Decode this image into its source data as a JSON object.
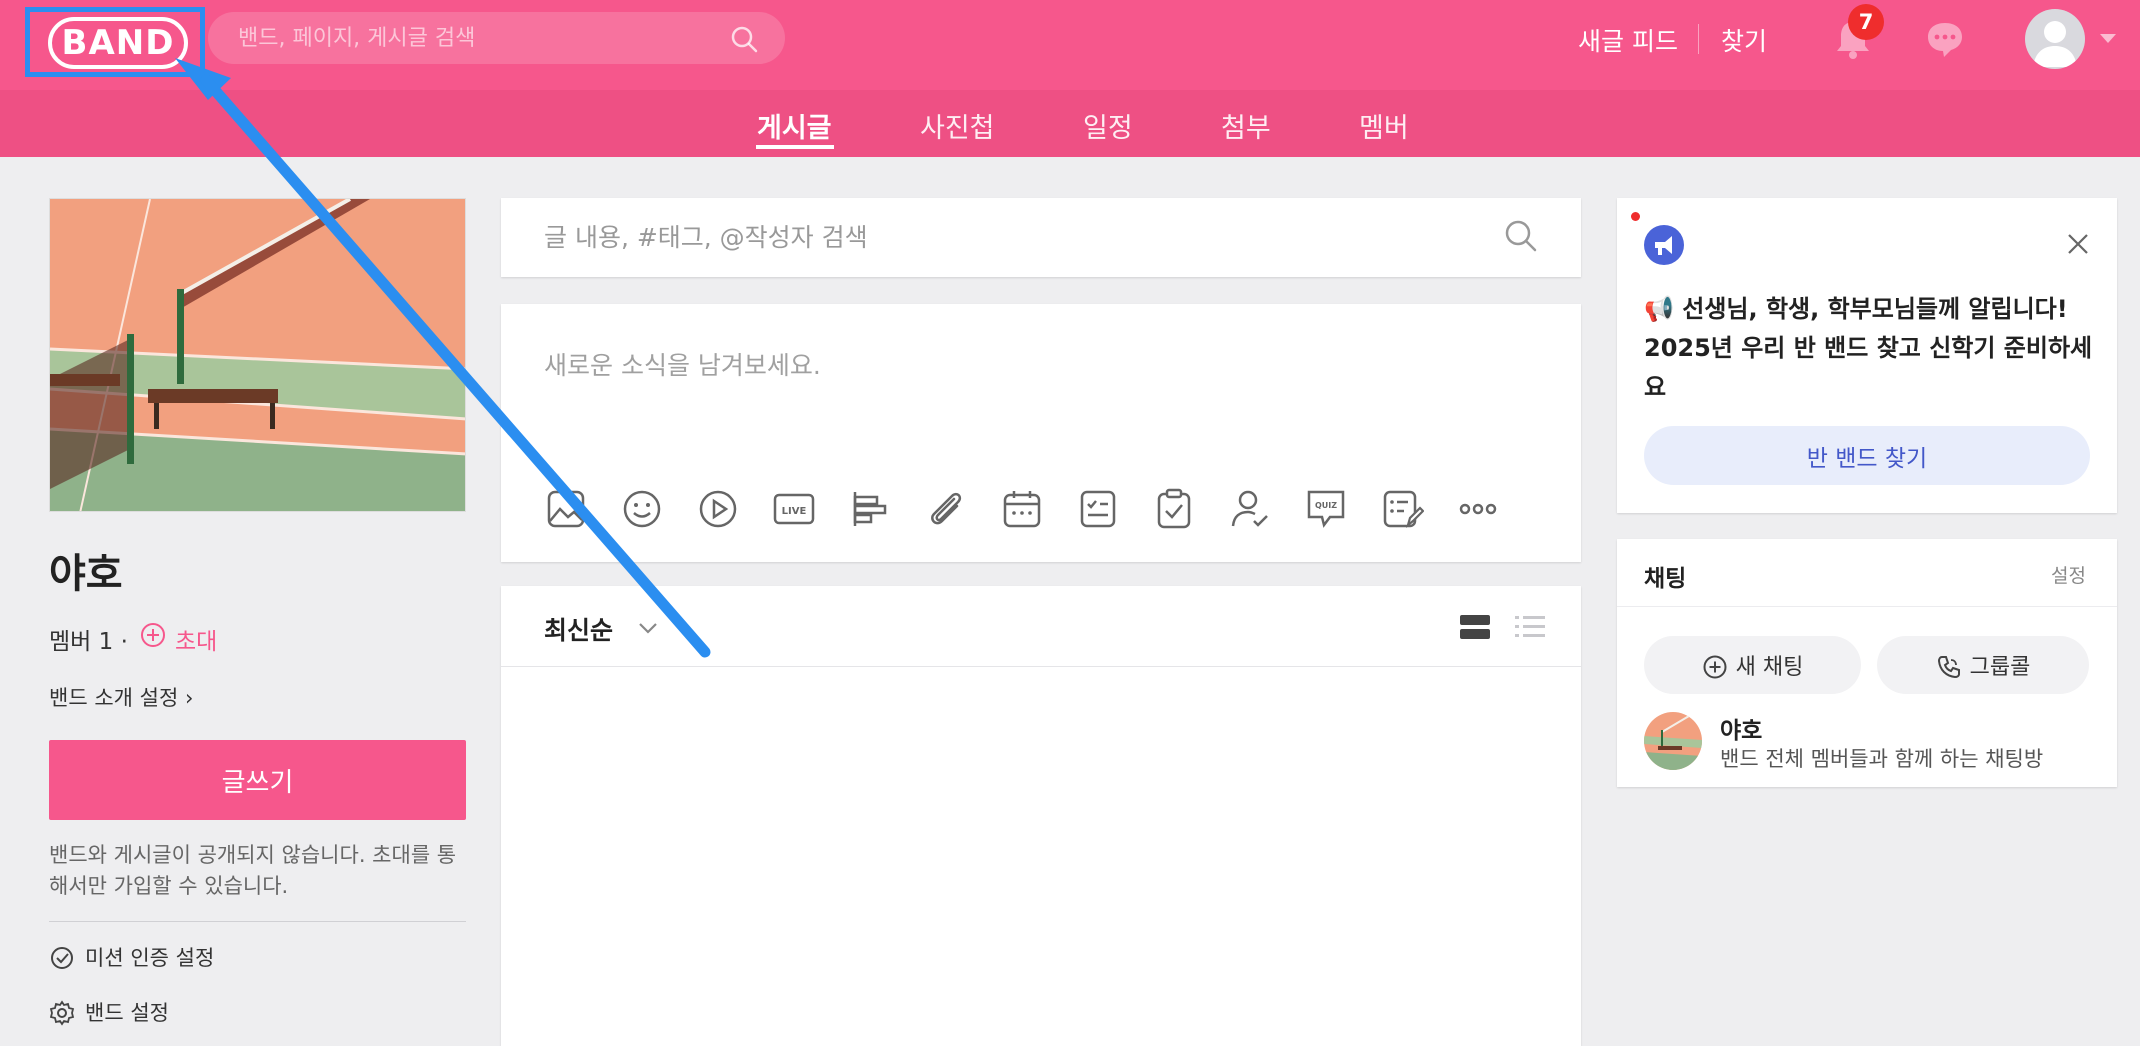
{
  "header": {
    "logo_text": "BAND",
    "search_placeholder": "밴드, 페이지, 게시글 검색",
    "new_feed": "새글 피드",
    "find": "찾기",
    "notification_count": "7"
  },
  "tabs": [
    {
      "label": "게시글",
      "active": true
    },
    {
      "label": "사진첩",
      "active": false
    },
    {
      "label": "일정",
      "active": false
    },
    {
      "label": "첨부",
      "active": false
    },
    {
      "label": "멤버",
      "active": false
    }
  ],
  "band": {
    "name": "야호",
    "members": "멤버 1 ·",
    "invite": "초대",
    "intro_setting": "밴드 소개 설정 ›",
    "write_button": "글쓰기",
    "privacy_notice": "밴드와 게시글이 공개되지 않습니다. 초대를 통해서만 가입할 수 있습니다.",
    "mission_setting": "미션 인증 설정",
    "band_setting": "밴드 설정"
  },
  "post_search": {
    "placeholder": "글 내용, #태그, @작성자 검색"
  },
  "compose": {
    "placeholder": "새로운 소식을 남겨보세요.",
    "tools": [
      "photo-icon",
      "sticker-icon",
      "video-icon",
      "live-icon",
      "poll-icon",
      "attach-icon",
      "calendar-icon",
      "todo-icon",
      "checklist-icon",
      "attendance-icon",
      "quiz-icon",
      "form-icon",
      "more-icon"
    ],
    "live_label": "LIVE",
    "quiz_label": "QUIZ"
  },
  "feed": {
    "sort": "최신순"
  },
  "promo": {
    "text": "📢 선생님, 학생, 학부모님들께 알립니다! 2025년 우리 반 밴드 찾고 신학기 준비하세요",
    "button": "반 밴드 찾기"
  },
  "chat": {
    "title": "채팅",
    "settings": "설정",
    "new_chat": "새 채팅",
    "group_call": "그룹콜",
    "room_name": "야호",
    "room_desc": "밴드 전체 멤버들과 함께 하는 채팅방"
  },
  "colors": {
    "brand_pink": "#f6578c",
    "highlight_blue": "#2b8ef0"
  }
}
